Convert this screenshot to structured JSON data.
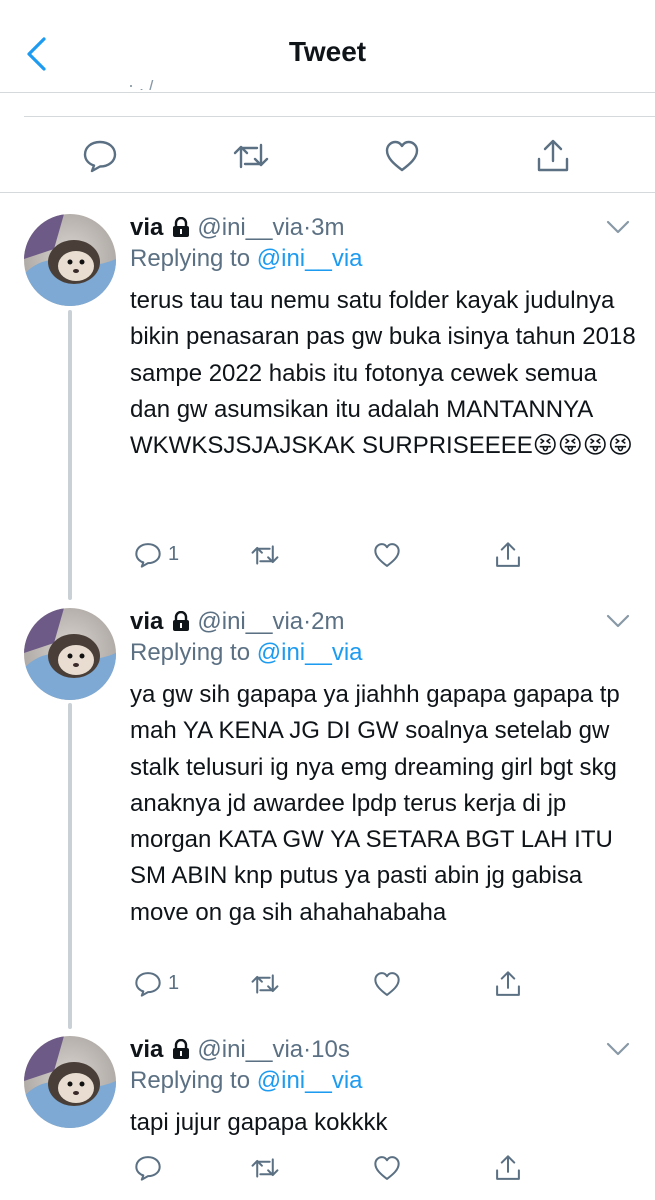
{
  "header": {
    "title": "Tweet"
  },
  "main_tweet_actions": [
    "reply-icon",
    "retweet-icon",
    "like-icon",
    "share-icon"
  ],
  "colors": {
    "accent": "#1d9bf0",
    "muted": "#5b7083",
    "thread_line": "#c9d0d6"
  },
  "replies": [
    {
      "name": "via",
      "handle": "@ini__via",
      "dot": "·",
      "time": "3m",
      "replying_prefix": "Replying to",
      "replying_to": "@ini__via",
      "text": "terus tau tau nemu satu folder kayak judulnya bikin penasaran pas gw buka isinya tahun 2018 sampe 2022 habis itu fotonya cewek semua dan gw asumsikan itu adalah MANTANNYA WKWKSJSJAJSKAK SURPRISEEEE😝😝😝😝",
      "reply_count": "1"
    },
    {
      "name": "via",
      "handle": "@ini__via",
      "dot": "·",
      "time": "2m",
      "replying_prefix": "Replying to",
      "replying_to": "@ini__via",
      "text": "ya gw sih gapapa ya jiahhh gapapa gapapa tp mah YA KENA JG DI GW soalnya setelab gw stalk telusuri ig nya emg dreaming girl bgt skg anaknya jd awardee lpdp terus kerja di jp morgan KATA GW YA SETARA BGT LAH ITU SM ABIN knp putus ya pasti abin jg gabisa move on ga sih ahahahabaha",
      "reply_count": "1"
    },
    {
      "name": "via",
      "handle": "@ini__via",
      "dot": "·",
      "time": "10s",
      "replying_prefix": "Replying to",
      "replying_to": "@ini__via",
      "text": "tapi jujur gapapa kokkkk",
      "reply_count": ""
    }
  ]
}
